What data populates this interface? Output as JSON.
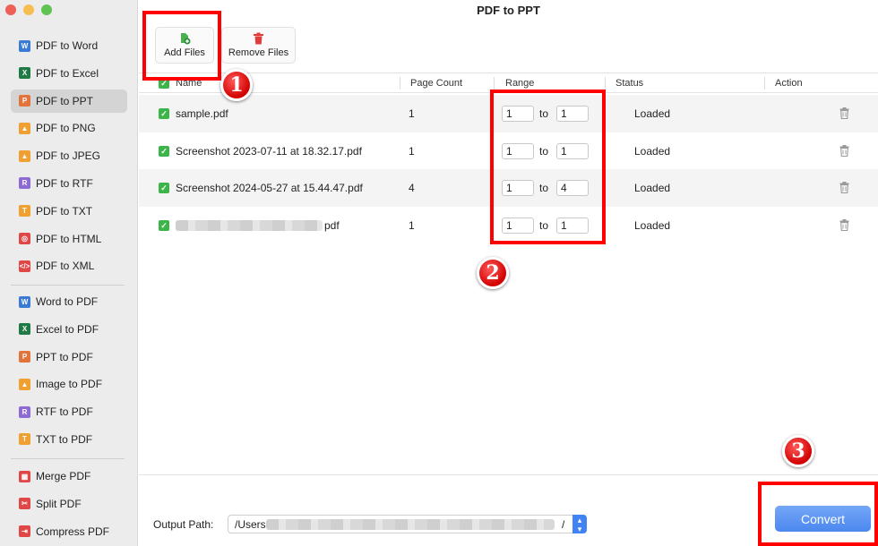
{
  "window": {
    "title": "PDF to PPT"
  },
  "sidebar": {
    "groups": [
      [
        {
          "label": "PDF to Word",
          "icon": "word-icon",
          "color": "#3a7bd5",
          "glyph": "W"
        },
        {
          "label": "PDF to Excel",
          "icon": "excel-icon",
          "color": "#1f7a45",
          "glyph": "X"
        },
        {
          "label": "PDF to PPT",
          "icon": "ppt-icon",
          "color": "#e2733a",
          "glyph": "P",
          "active": true
        },
        {
          "label": "PDF to PNG",
          "icon": "png-icon",
          "color": "#f0a030",
          "glyph": "▲"
        },
        {
          "label": "PDF to JPEG",
          "icon": "jpeg-icon",
          "color": "#f0a030",
          "glyph": "▲"
        },
        {
          "label": "PDF to RTF",
          "icon": "rtf-icon",
          "color": "#8e6bd4",
          "glyph": "R"
        },
        {
          "label": "PDF to TXT",
          "icon": "txt-icon",
          "color": "#f0a030",
          "glyph": "T"
        },
        {
          "label": "PDF to HTML",
          "icon": "html-icon",
          "color": "#e04848",
          "glyph": "◎"
        },
        {
          "label": "PDF to XML",
          "icon": "xml-icon",
          "color": "#e04848",
          "glyph": "</>"
        }
      ],
      [
        {
          "label": "Word to PDF",
          "icon": "word-icon",
          "color": "#3a7bd5",
          "glyph": "W"
        },
        {
          "label": "Excel to PDF",
          "icon": "excel-icon",
          "color": "#1f7a45",
          "glyph": "X"
        },
        {
          "label": "PPT to PDF",
          "icon": "ppt-icon",
          "color": "#e2733a",
          "glyph": "P"
        },
        {
          "label": "Image to PDF",
          "icon": "image-icon",
          "color": "#f0a030",
          "glyph": "▲"
        },
        {
          "label": "RTF to PDF",
          "icon": "rtf-icon",
          "color": "#8e6bd4",
          "glyph": "R"
        },
        {
          "label": "TXT to PDF",
          "icon": "txt-icon",
          "color": "#f0a030",
          "glyph": "T"
        }
      ],
      [
        {
          "label": "Merge PDF",
          "icon": "merge-icon",
          "color": "#e04848",
          "glyph": "▦"
        },
        {
          "label": "Split PDF",
          "icon": "split-icon",
          "color": "#e04848",
          "glyph": "✂"
        },
        {
          "label": "Compress PDF",
          "icon": "compress-icon",
          "color": "#e04848",
          "glyph": "⇥"
        }
      ]
    ]
  },
  "toolbar": {
    "add_label": "Add Files",
    "remove_label": "Remove Files"
  },
  "table": {
    "columns": [
      "Name",
      "Page Count",
      "Range",
      "Status",
      "Action"
    ],
    "range_separator": "to",
    "rows": [
      {
        "name": "sample.pdf",
        "pages": "1",
        "from": "1",
        "to": "1",
        "status": "Loaded"
      },
      {
        "name": "Screenshot 2023-07-11 at 18.32.17.pdf",
        "pages": "1",
        "from": "1",
        "to": "1",
        "status": "Loaded"
      },
      {
        "name": "Screenshot 2024-05-27 at 15.44.47.pdf",
        "pages": "4",
        "from": "1",
        "to": "4",
        "status": "Loaded"
      },
      {
        "name": "pdf",
        "pages": "1",
        "from": "1",
        "to": "1",
        "status": "Loaded",
        "redacted": true
      }
    ]
  },
  "footer": {
    "output_label": "Output Path:",
    "output_value": "/Users",
    "output_trailing": "/",
    "convert_label": "Convert"
  },
  "annotations": [
    "1",
    "2",
    "3"
  ],
  "colors": {
    "accent": "#4b87ee",
    "highlight": "#ff0000",
    "check": "#3bb54a"
  }
}
